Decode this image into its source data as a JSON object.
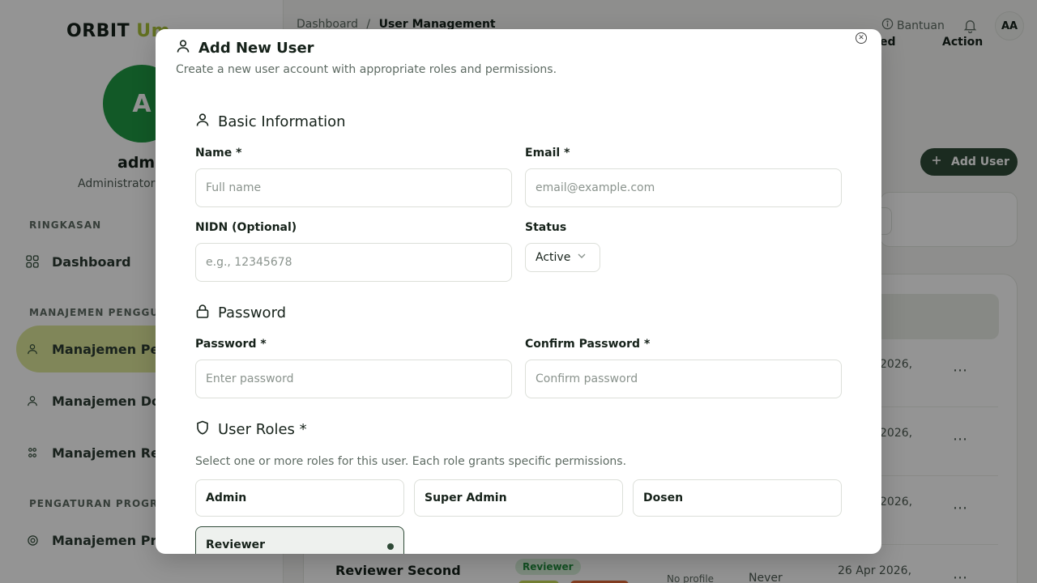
{
  "app": {
    "logo_main": "ORBIT",
    "logo_accent": "Um",
    "profile_initial": "A",
    "profile_name": "admi",
    "profile_role": "Administrator",
    "sections": [
      "RINGKASAN",
      "MANAJEMEN PENGGUNA",
      "PENGATURAN PROGRAM"
    ],
    "nav": {
      "dashboard": "Dashboard",
      "users": "Manajemen Pen",
      "dosen": "Manajemen Dos",
      "reviewer": "Manajemen Rev",
      "program": "Manajemen Pro"
    },
    "breadcrumb_root": "Dashboard",
    "breadcrumb_sep": "/",
    "breadcrumb_current": "User Management",
    "help_label": "Bantuan",
    "avatar_initials": "AA",
    "add_user_label": "Add User",
    "table_headers": {
      "col_partial": "ed",
      "action": "Action"
    },
    "rows": [
      {
        "date": "2026,"
      },
      {
        "date": "2026,"
      },
      {
        "date": "2026,"
      }
    ],
    "bottom_row": {
      "name": "Reviewer Second",
      "badge": "Reviewer",
      "profile": "No profile",
      "last": "Never",
      "date": "26 Apr 2026,"
    },
    "more_glyph": "⋯"
  },
  "modal": {
    "title": "Add New User",
    "subtitle": "Create a new user account with appropriate roles and permissions.",
    "basic": {
      "title": "Basic Information",
      "name_label": "Name *",
      "name_placeholder": "Full name",
      "email_label": "Email *",
      "email_placeholder": "email@example.com",
      "nidn_label": "NIDN (Optional)",
      "nidn_placeholder": "e.g., 12345678",
      "status_label": "Status",
      "status_value": "Active"
    },
    "password": {
      "title": "Password",
      "password_label": "Password *",
      "password_placeholder": "Enter password",
      "confirm_label": "Confirm Password *",
      "confirm_placeholder": "Confirm password"
    },
    "roles": {
      "title": "User Roles *",
      "description": "Select one or more roles for this user. Each role grants specific permissions.",
      "items": [
        {
          "label": "Admin",
          "selected": false
        },
        {
          "label": "Super Admin",
          "selected": false
        },
        {
          "label": "Dosen",
          "selected": false
        },
        {
          "label": "Reviewer",
          "selected": true
        }
      ]
    }
  },
  "colors": {
    "primary": "#2f4a37",
    "accent": "#a9c23a",
    "avatar_bg": "#1f9a44",
    "nav_active_bg": "#dde79a"
  },
  "icons": {
    "close": "close-icon",
    "user": "user-icon",
    "lock": "lock-icon",
    "shield": "shield-icon",
    "chevron": "chevron-down-icon",
    "bell": "bell-icon",
    "help": "help-circle-icon",
    "plus": "plus-icon"
  }
}
